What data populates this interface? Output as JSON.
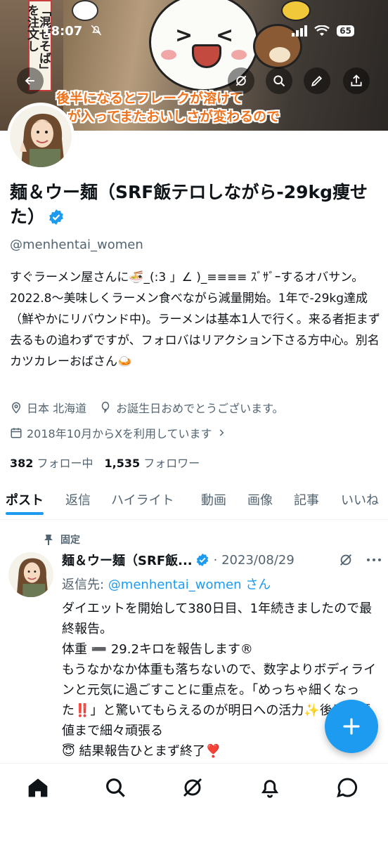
{
  "status_bar": {
    "time": "18:07",
    "battery": "65"
  },
  "banner": {
    "sign_text": "「混ぜそば」を注文し",
    "caption_line1": "後半になるとフレークが溶けて",
    "caption_line2": "が入ってまたおいしさが変わるので"
  },
  "profile": {
    "name": "麺＆ウー麺（SRF飯テロしながら-29kg痩せた）",
    "handle": "@menhentai_women",
    "bio": "すぐラーメン屋さんに🍜_(:3 」∠ )_≡≡≡≡ ｽﾞｻﾞｰするオバサン。2022.8～美味しくラーメン食べながら減量開始。1年で-29kg達成（鮮やかにリバウンド中)。ラーメンは基本1人で行く。来る者拒まず去るもの追わずですが、フォロバはリアクション下さる方中心。別名カツカレーおばさん🍛",
    "location": "日本 北海道",
    "birthday": "お誕生日おめでとうございます。",
    "joined": "2018年10月からXを利用しています",
    "following_count": "382",
    "following_label": "フォロー中",
    "followers_count": "1,535",
    "followers_label": "フォロワー"
  },
  "tabs": [
    "ポスト",
    "返信",
    "ハイライト",
    "動画",
    "画像",
    "記事",
    "いいね"
  ],
  "post": {
    "pinned_label": "固定",
    "name": "麺＆ウー麺（SRF飯...",
    "date": "· 2023/08/29",
    "reply_prefix": "返信先: ",
    "reply_handle": "@menhentai_women",
    "reply_suffix": "さん",
    "body": "ダイエットを開始して380日目、1年続きましたので最終報告。\n体重 ➖ 29.2キロを報告します®\nもうなかなか体重も落ちないので、数字よりボディラインと元気に過ごすことに重点を。「めっちゃ細くなった‼️」と驚いてもらえるのが明日への活力✨後は目標値まで細々頑張る\n😇 結果報告ひとまず終了❣️"
  },
  "colors": {
    "accent": "#1d9bf0",
    "muted": "#536471",
    "caption_orange": "#f0731e"
  },
  "icons": [
    "back-icon",
    "grok-icon",
    "search-icon",
    "edit-icon",
    "share-icon",
    "verified-icon",
    "location-icon",
    "balloon-icon",
    "calendar-icon",
    "pin-icon",
    "compose-icon",
    "home-icon",
    "communities-icon",
    "bell-icon",
    "messages-icon"
  ]
}
